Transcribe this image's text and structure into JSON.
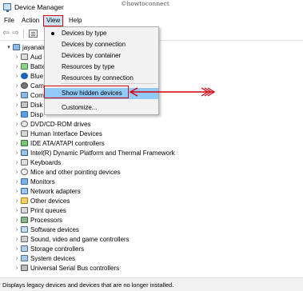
{
  "window": {
    "title": "Device Manager",
    "watermark": "©howtoconnect"
  },
  "menubar": {
    "file": "File",
    "action": "Action",
    "view": "View",
    "help": "Help"
  },
  "tree": {
    "root": "jayanair",
    "items": [
      {
        "label": "Aud",
        "icon": "audio-icon"
      },
      {
        "label": "Batte",
        "icon": "battery-icon"
      },
      {
        "label": "Blue",
        "icon": "bluetooth-icon"
      },
      {
        "label": "Cam",
        "icon": "camera-icon"
      },
      {
        "label": "Com",
        "icon": "computer-icon"
      },
      {
        "label": "Disk",
        "icon": "disk-drive-icon"
      },
      {
        "label": "Disp",
        "icon": "display-adapter-icon"
      },
      {
        "label": "DVD/CD-ROM drives",
        "icon": "dvd-drive-icon"
      },
      {
        "label": "Human Interface Devices",
        "icon": "hid-icon"
      },
      {
        "label": "IDE ATA/ATAPI controllers",
        "icon": "ide-controller-icon"
      },
      {
        "label": "Intel(R) Dynamic Platform and Thermal Framework",
        "icon": "intel-icon"
      },
      {
        "label": "Keyboards",
        "icon": "keyboard-icon"
      },
      {
        "label": "Mice and other pointing devices",
        "icon": "mouse-icon"
      },
      {
        "label": "Monitors",
        "icon": "monitor-icon"
      },
      {
        "label": "Network adapters",
        "icon": "network-icon"
      },
      {
        "label": "Other devices",
        "icon": "other-devices-icon"
      },
      {
        "label": "Print queues",
        "icon": "printer-icon"
      },
      {
        "label": "Processors",
        "icon": "processor-icon"
      },
      {
        "label": "Software devices",
        "icon": "software-icon"
      },
      {
        "label": "Sound, video and game controllers",
        "icon": "sound-icon"
      },
      {
        "label": "Storage controllers",
        "icon": "storage-icon"
      },
      {
        "label": "System devices",
        "icon": "system-icon"
      },
      {
        "label": "Universal Serial Bus controllers",
        "icon": "usb-icon"
      }
    ]
  },
  "view_menu": {
    "devices_by_type": "Devices by type",
    "devices_by_connection": "Devices by connection",
    "devices_by_container": "Devices by container",
    "resources_by_type": "Resources by type",
    "resources_by_connection": "Resources by connection",
    "show_hidden_devices": "Show hidden devices",
    "customize": "Customize..."
  },
  "status": {
    "text": "Displays legacy devices and devices that are no longer installed."
  },
  "colors": {
    "highlight": "#91c9f7",
    "callout_red": "#d9000d",
    "menu_bg": "#f2f2f2"
  }
}
